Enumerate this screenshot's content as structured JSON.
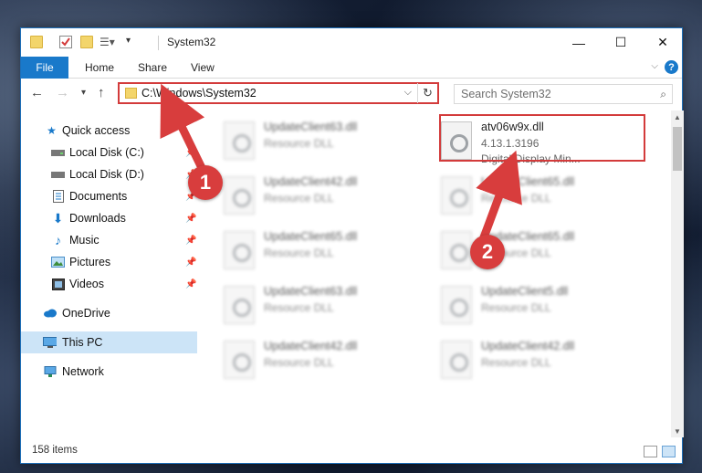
{
  "window": {
    "title": "System32",
    "controls": {
      "minimize": "—",
      "maximize": "☐",
      "close": "✕"
    }
  },
  "ribbon": {
    "tabs": [
      "File",
      "Home",
      "Share",
      "View"
    ],
    "help": "?"
  },
  "nav": {
    "address": "C:\\Windows\\System32",
    "search_placeholder": "Search System32"
  },
  "sidebar": {
    "items": [
      {
        "label": "Quick access",
        "icon": "star-icon",
        "pinned": false
      },
      {
        "label": "Local Disk (C:)",
        "icon": "drive-icon",
        "pinned": true
      },
      {
        "label": "Local Disk (D:)",
        "icon": "drive-icon",
        "pinned": true
      },
      {
        "label": "Documents",
        "icon": "documents-icon",
        "pinned": true
      },
      {
        "label": "Downloads",
        "icon": "download-icon",
        "pinned": true
      },
      {
        "label": "Music",
        "icon": "music-icon",
        "pinned": true
      },
      {
        "label": "Pictures",
        "icon": "pictures-icon",
        "pinned": true
      },
      {
        "label": "Videos",
        "icon": "videos-icon",
        "pinned": true
      },
      {
        "label": "OneDrive",
        "icon": "cloud-icon",
        "pinned": false
      },
      {
        "label": "This PC",
        "icon": "computer-icon",
        "pinned": false,
        "selected": true
      },
      {
        "label": "Network",
        "icon": "network-icon",
        "pinned": false
      }
    ]
  },
  "files": {
    "highlighted": {
      "name": "atv06w9x.dll",
      "version": "4.13.1.3196",
      "description": "Digital Display Min..."
    },
    "blurred": [
      {
        "name": "UpdateClient63.dll",
        "type": "Resource DLL"
      },
      {
        "name": "UpdateClient42.dll",
        "type": "Resource DLL"
      },
      {
        "name": "UpdateClient65.dll",
        "type": "Resource DLL"
      },
      {
        "name": "UpdateClient65.dll",
        "type": "Resource DLL"
      },
      {
        "name": "UpdateClient65.dll",
        "type": "Resource DLL"
      },
      {
        "name": "UpdateClient63.dll",
        "type": "Resource DLL"
      },
      {
        "name": "UpdateClient5.dll",
        "type": "Resource DLL"
      },
      {
        "name": "UpdateClient42.dll",
        "type": "Resource DLL"
      },
      {
        "name": "UpdateClient42.dll",
        "type": "Resource DLL"
      }
    ]
  },
  "status": {
    "items": "158 items"
  },
  "annotations": {
    "step1": "1",
    "step2": "2"
  },
  "colors": {
    "accent": "#1979ca",
    "highlight": "#d33b3b",
    "selected": "#cce4f7"
  }
}
